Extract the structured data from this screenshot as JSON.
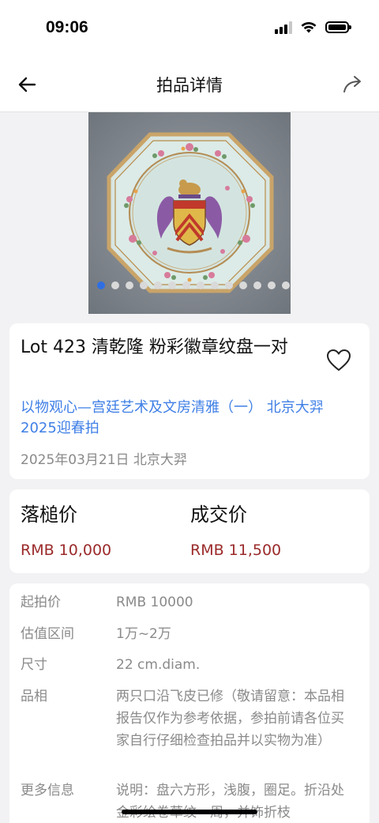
{
  "status_bar": {
    "time": "09:06"
  },
  "nav": {
    "title": "拍品详情"
  },
  "carousel": {
    "image_alt": "清乾隆 粉彩徽章纹盘",
    "dot_count": 14,
    "active_index": 0
  },
  "lot": {
    "title": "Lot 423 清乾隆 粉彩徽章纹盘一对",
    "auction": "以物观心—宫廷艺术及文房清雅（一） 北京大羿2025迎春拍",
    "date": "2025年03月21日 北京大羿"
  },
  "prices": {
    "hammer_label": "落槌价",
    "hammer_value": "RMB 10,000",
    "deal_label": "成交价",
    "deal_value": "RMB 11,500"
  },
  "details": [
    {
      "key": "起拍价",
      "value": "RMB 10000"
    },
    {
      "key": "估值区间",
      "value": "1万~2万"
    },
    {
      "key": "尺寸",
      "value": "22 cm.diam."
    },
    {
      "key": "品相",
      "value": "两只口沿飞皮已修（敬请留意：本品相报告仅作为参考依据，参拍前请各位买家自行仔细检查拍品并以实物为准）"
    },
    {
      "key": "更多信息",
      "value": "说明：盘六方形，浅腹，圈足。折沿处金彩绘卷草纹一周，并饰折枝"
    }
  ],
  "colors": {
    "accent": "#2f6fe3",
    "link": "#3f7fe6",
    "price": "#9b2a2a",
    "muted": "#8a8a8a"
  },
  "icons": [
    "back-arrow-icon",
    "share-icon",
    "heart-outline-icon",
    "signal-icon",
    "wifi-icon",
    "battery-icon"
  ]
}
